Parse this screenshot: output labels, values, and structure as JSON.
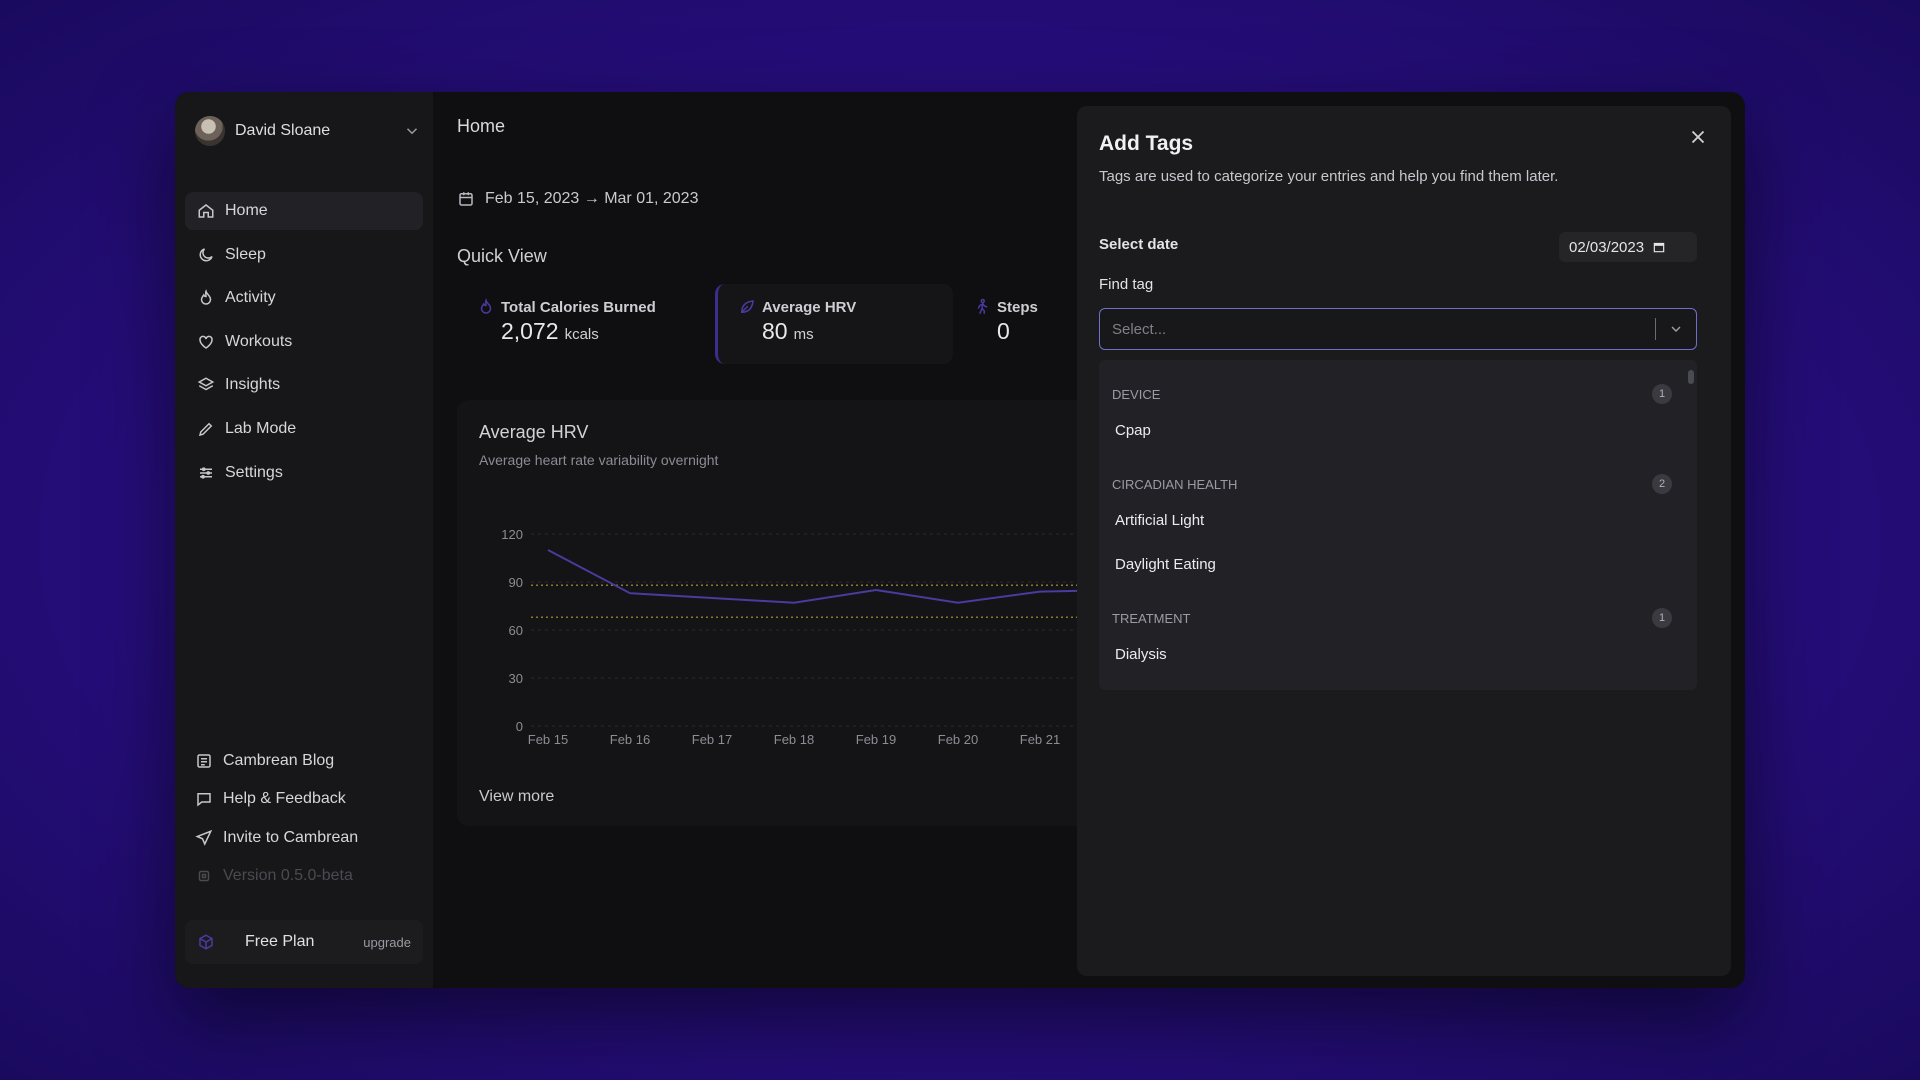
{
  "user": {
    "name": "David Sloane"
  },
  "nav": {
    "items": [
      {
        "label": "Home",
        "icon": "home-icon",
        "active": true
      },
      {
        "label": "Sleep",
        "icon": "moon-icon",
        "active": false
      },
      {
        "label": "Activity",
        "icon": "flame-icon",
        "active": false
      },
      {
        "label": "Workouts",
        "icon": "heart-icon",
        "active": false
      },
      {
        "label": "Insights",
        "icon": "layers-icon",
        "active": false
      },
      {
        "label": "Lab Mode",
        "icon": "pencil-icon",
        "active": false
      },
      {
        "label": "Settings",
        "icon": "sliders-icon",
        "active": false
      }
    ]
  },
  "footer_links": [
    {
      "label": "Cambrean Blog",
      "icon": "newspaper-icon"
    },
    {
      "label": "Help & Feedback",
      "icon": "message-icon"
    },
    {
      "label": "Invite to Cambrean",
      "icon": "send-icon"
    },
    {
      "label": "Version 0.5.0-beta",
      "icon": "cpu-icon"
    }
  ],
  "plan": {
    "name": "Free Plan",
    "upgrade": "upgrade"
  },
  "main": {
    "title": "Home",
    "date_range": "Feb 15, 2023 → Mar 01, 2023",
    "quick_view": "Quick View",
    "stats": [
      {
        "label": "Total Calories Burned",
        "value": "2,072",
        "unit": "kcals",
        "icon": "flame-icon"
      },
      {
        "label": "Average HRV",
        "value": "80",
        "unit": "ms",
        "icon": "leaf-icon"
      },
      {
        "label": "Steps",
        "value": "0",
        "unit": "",
        "icon": "walking-icon"
      }
    ],
    "chart_card": {
      "title": "Average HRV",
      "subtitle": "Average heart rate variability overnight",
      "view_more": "View more"
    }
  },
  "chart_data": {
    "type": "line",
    "categories": [
      "Feb 15",
      "Feb 16",
      "Feb 17",
      "Feb 18",
      "Feb 19",
      "Feb 20",
      "Feb 21"
    ],
    "series": [
      {
        "values": [
          110,
          83,
          80,
          77,
          85,
          77,
          84,
          85
        ]
      }
    ],
    "reference_lines": [
      88,
      68
    ],
    "yticks": [
      0,
      30,
      60,
      90,
      120
    ],
    "ylim": [
      0,
      120
    ],
    "grid": true,
    "line_color": "#4b3a9f",
    "ref_color": "#8a7a2e"
  },
  "modal": {
    "title": "Add Tags",
    "description": "Tags are used to categorize your entries and help you find them later.",
    "select_date_label": "Select date",
    "date_value": "02/03/2023",
    "find_tag_label": "Find tag",
    "find_tag_placeholder": "Select...",
    "groups": [
      {
        "name": "DEVICE",
        "count": "1",
        "options": [
          "Cpap"
        ]
      },
      {
        "name": "CIRCADIAN HEALTH",
        "count": "2",
        "options": [
          "Artificial Light",
          "Daylight Eating"
        ]
      },
      {
        "name": "TREATMENT",
        "count": "1",
        "options": [
          "Dialysis"
        ]
      }
    ]
  }
}
